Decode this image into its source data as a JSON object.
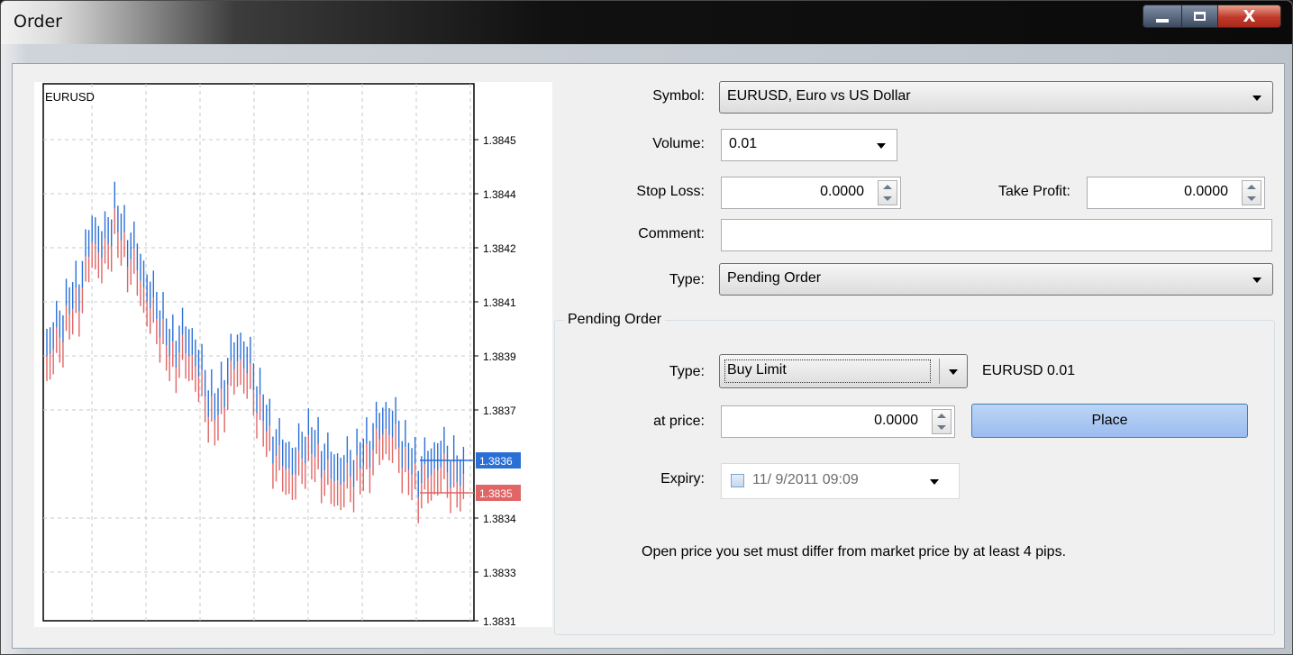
{
  "window": {
    "title": "Order",
    "close_glyph": "X"
  },
  "chart": {
    "symbol": "EURUSD",
    "price_labels": [
      "1.3845",
      "1.3844",
      "1.3842",
      "1.3841",
      "1.3839",
      "1.3837",
      "1.3834",
      "1.3833",
      "1.3831"
    ],
    "ask_tag": "1.3836",
    "bid_tag": "1.3835",
    "ask_color": "#2a6fd6",
    "bid_color": "#e06565"
  },
  "form": {
    "symbol_label": "Symbol:",
    "symbol_value": "EURUSD, Euro vs US Dollar",
    "volume_label": "Volume:",
    "volume_value": "0.01",
    "stop_loss_label": "Stop Loss:",
    "stop_loss_value": "0.0000",
    "take_profit_label": "Take Profit:",
    "take_profit_value": "0.0000",
    "comment_label": "Comment:",
    "comment_value": "",
    "type_label": "Type:",
    "type_value": "Pending Order"
  },
  "pending": {
    "group_title": "Pending Order",
    "type_label": "Type:",
    "type_value": "Buy Limit",
    "summary": "EURUSD 0.01",
    "price_label": "at price:",
    "price_value": "0.0000",
    "place_button": "Place",
    "expiry_label": "Expiry:",
    "expiry_value": "11/ 9/2011 09:09",
    "note": "Open price you set must differ from market price by at least 4 pips."
  }
}
